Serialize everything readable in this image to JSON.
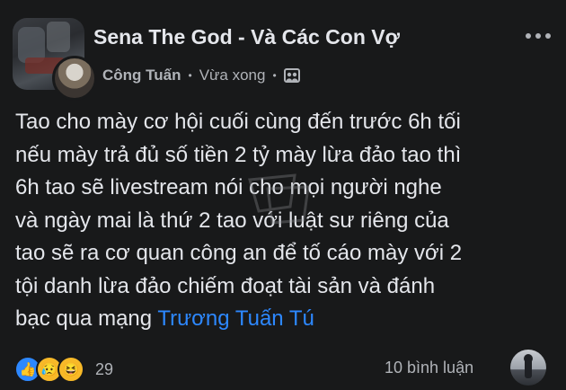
{
  "header": {
    "group_name": "Sena The God - Và Các Con Vợ",
    "author": "Công Tuấn",
    "separator": "•",
    "timestamp": "Vừa xong",
    "privacy_icon": "group-privacy-icon",
    "more_icon": "more-options-icon"
  },
  "post": {
    "lines": [
      "Tao cho mày cơ hội cuối cùng đến trước 6h tối",
      "nếu mày trả đủ số tiền 2 tỷ mày lừa đảo tao thì",
      "6h tao sẽ livestream nói cho mọi người nghe",
      "và ngày mai là thứ 2 tao với luật sư riêng của",
      "tao sẽ ra cơ quan công an để tố cáo mày với 2",
      "tội danh lừa đảo chiếm đoạt tài sản và đánh"
    ],
    "last_line_text": "bạc qua mạng",
    "mention": "Trương Tuấn Tú"
  },
  "footer": {
    "reaction_icons": [
      "like-icon",
      "sad-icon",
      "haha-icon"
    ],
    "reaction_count": "29",
    "comments": "10 bình luận"
  },
  "colors": {
    "background": "#18191a",
    "text": "#e4e6eb",
    "secondary": "#b0b3b8",
    "mention": "#2d88ff"
  }
}
